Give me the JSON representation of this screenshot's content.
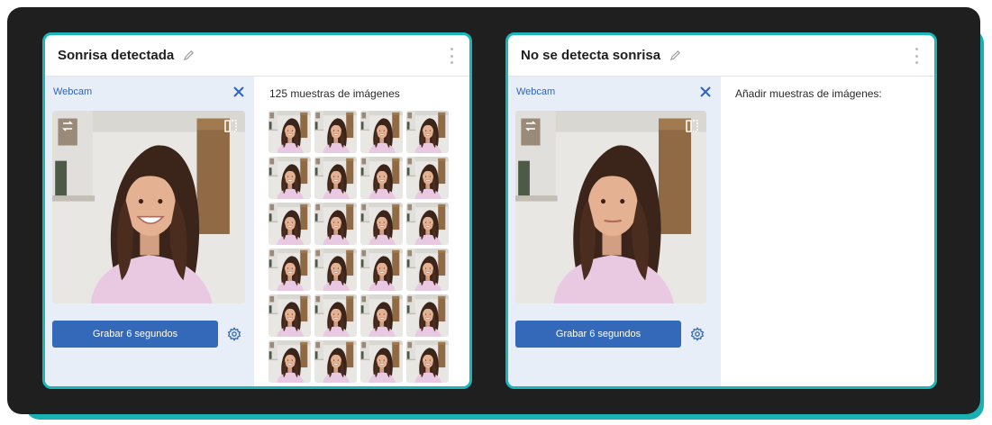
{
  "panels": [
    {
      "title": "Sonrisa detectada",
      "webcam_label": "Webcam",
      "record_button_label": "Grabar 6 segundos",
      "samples_label": "125 muestras de imágenes",
      "visible_thumbnails": 24
    },
    {
      "title": "No se detecta sonrisa",
      "webcam_label": "Webcam",
      "record_button_label": "Grabar 6 segundos",
      "samples_label": "Añadir muestras de imágenes:",
      "visible_thumbnails": 0
    }
  ],
  "colors": {
    "frame_accent": "#1ab0b3",
    "frame_dark": "#1f1f20",
    "panel_border": "#1bb6b9",
    "webcam_column_bg": "#e7eef8",
    "button_blue": "#3468b8",
    "link_blue": "#2f63c5"
  },
  "icons": {
    "edit": "pencil-icon",
    "menu": "more-vert-icon",
    "close": "close-icon",
    "flip": "flip-icon",
    "mirror": "mirror-icon",
    "settings": "gear-icon"
  }
}
